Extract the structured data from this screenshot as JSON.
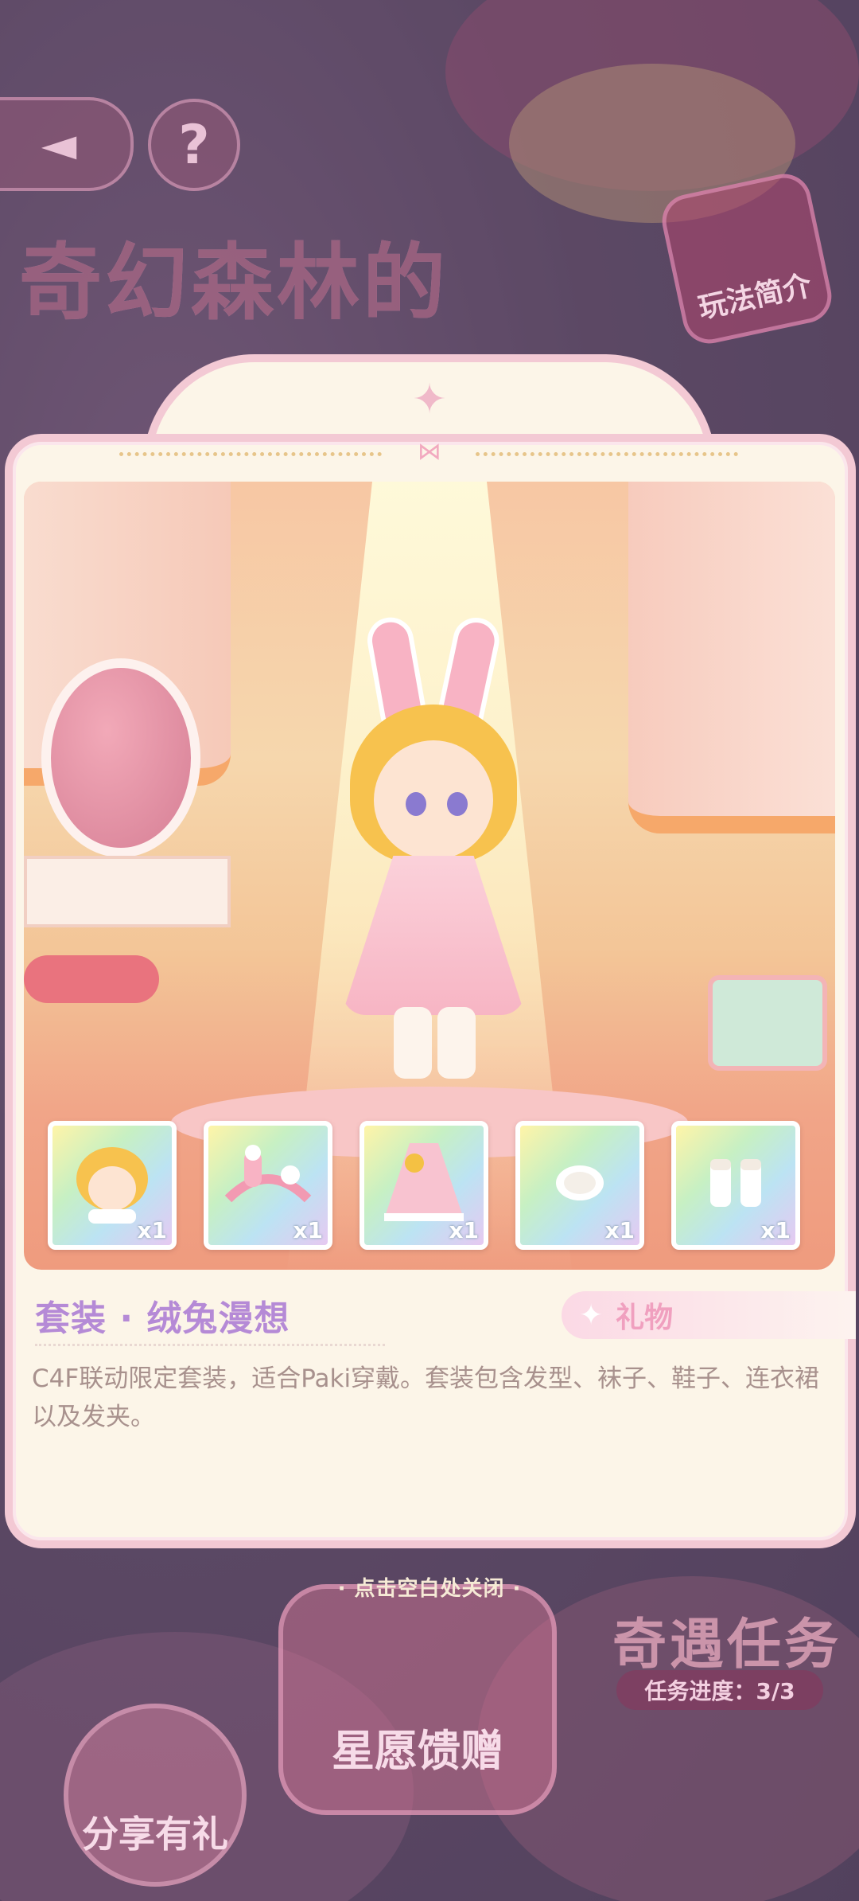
{
  "background": {
    "title": "奇幻森林的",
    "intro_label": "玩法简介",
    "mission_title": "奇遇任务",
    "mission_progress": "任务进度：3/3",
    "wish_label": "星愿馈赠",
    "share_label": "分享有礼"
  },
  "modal": {
    "items": [
      {
        "name": "hair",
        "count": "x1"
      },
      {
        "name": "headband",
        "count": "x1"
      },
      {
        "name": "dress",
        "count": "x1"
      },
      {
        "name": "hairclip",
        "count": "x1"
      },
      {
        "name": "socks",
        "count": "x1"
      }
    ],
    "outfit_title": "套装 · 绒兔漫想",
    "tag_label": "礼物",
    "description": "C4F联动限定套装，适合Paki穿戴。套装包含发型、袜子、鞋子、连衣裙以及发夹。"
  },
  "close_hint": "· 点击空白处关闭 ·",
  "colors": {
    "accent_pink": "#f3c9d4",
    "title_purple": "#b58ad6",
    "modal_bg": "#fcf5e8",
    "desc_text": "#a8918d"
  }
}
